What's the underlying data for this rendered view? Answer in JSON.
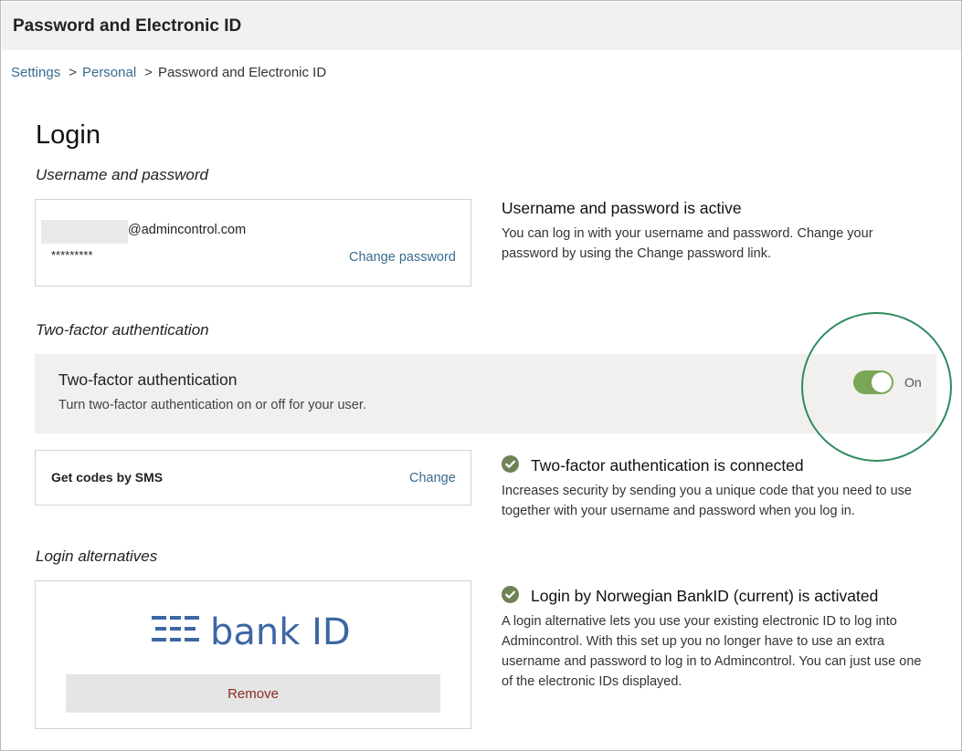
{
  "header": {
    "title": "Password and Electronic ID"
  },
  "breadcrumb": {
    "items": [
      "Settings",
      "Personal"
    ],
    "current": "Password and Electronic ID",
    "separator": ">"
  },
  "login": {
    "title": "Login",
    "username_section": {
      "heading": "Username and password",
      "email_suffix": "@admincontrol.com",
      "password_mask": "*********",
      "change_password_link": "Change password",
      "info_title": "Username and password is active",
      "info_body": "You can log in with your username and password. Change your password by using the Change password link."
    },
    "twofa_section": {
      "heading": "Two-factor authentication",
      "bar_title": "Two-factor authentication",
      "bar_description": "Turn two-factor authentication on or off for your user.",
      "toggle_state": "On",
      "toggle_on": true,
      "sms_label": "Get codes by SMS",
      "sms_change_link": "Change",
      "info_title": "Two-factor authentication is connected",
      "info_body": "Increases security by sending you a unique code that you need to use together with your username and password when you log in."
    },
    "alternatives_section": {
      "heading": "Login alternatives",
      "logo_text": "bank ID",
      "remove_button": "Remove",
      "info_title": "Login by Norwegian BankID (current) is activated",
      "info_body": "A login alternative lets you use your existing electronic ID to log into Admincontrol. With this set up you no longer have to use an extra username and password to log in to Admincontrol. You can just use one of the electronic IDs displayed."
    }
  },
  "colors": {
    "link": "#3a6c8f",
    "toggle_on": "#7aa657",
    "check": "#6f8257",
    "highlight_ring": "#2e8b5e",
    "remove_text": "#8b2a20",
    "bankid_blue": "#3c67a5"
  },
  "icons": {
    "check": "check-circle-icon",
    "logo": "bankid-logo"
  }
}
